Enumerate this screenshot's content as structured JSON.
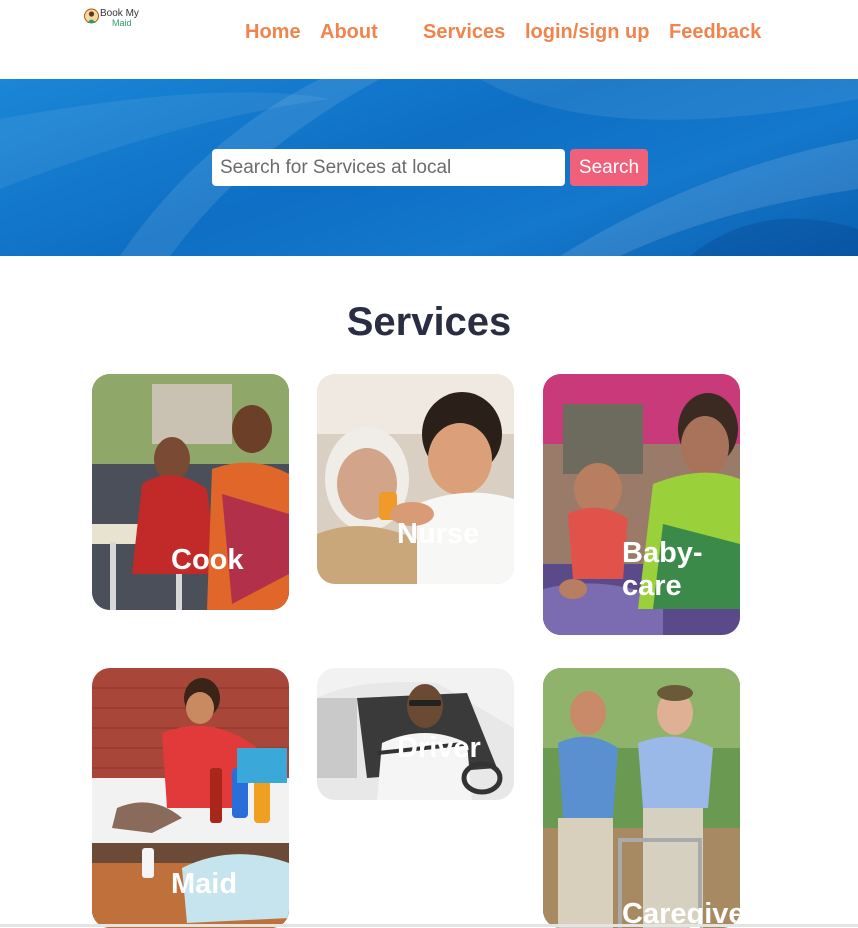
{
  "brand": {
    "line1": "Book My",
    "line2": "Maid"
  },
  "nav": {
    "home": "Home",
    "about": "About",
    "services": "Services",
    "login": "login/sign up",
    "feedback": "Feedback"
  },
  "search": {
    "placeholder": "Search for Services at local",
    "button": "Search"
  },
  "services_title": "Services",
  "cards": [
    {
      "label": "Cook"
    },
    {
      "label": "Nurse"
    },
    {
      "label": "Baby-\ncare"
    },
    {
      "label": "Maid"
    },
    {
      "label": "Driver"
    },
    {
      "label": "Caregiver"
    }
  ],
  "colors": {
    "nav_text": "#f0844c",
    "hero_blue": "#0e6fc4",
    "search_button": "#f0607a",
    "title_text": "#2b2d42"
  }
}
